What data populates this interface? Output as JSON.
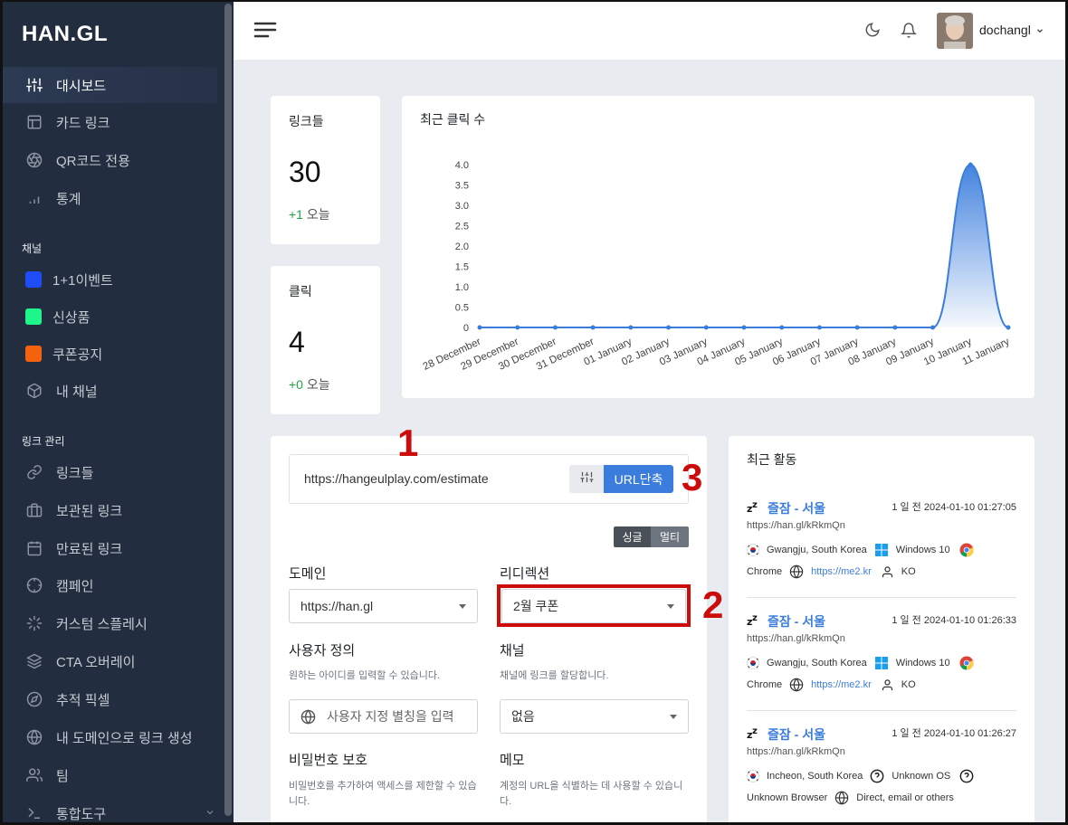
{
  "brand": {
    "logo": "HAN.GL"
  },
  "sidebar": {
    "main_items": [
      {
        "label": "대시보드",
        "icon": "sliders-icon"
      },
      {
        "label": "카드 링크",
        "icon": "layout-icon"
      },
      {
        "label": "QR코드 전용",
        "icon": "aperture-icon"
      },
      {
        "label": "통계",
        "icon": "bar-chart-icon"
      }
    ],
    "channel_header": "채널",
    "channels": [
      {
        "label": "1+1이벤트",
        "color": "#1f4cf5"
      },
      {
        "label": "신상품",
        "color": "#1ef58a"
      },
      {
        "label": "쿠폰공지",
        "color": "#f2620f"
      },
      {
        "label": "내 채널",
        "icon": "box-icon"
      }
    ],
    "link_header": "링크 관리",
    "link_items": [
      {
        "label": "링크들",
        "icon": "link-icon"
      },
      {
        "label": "보관된 링크",
        "icon": "briefcase-icon"
      },
      {
        "label": "만료된 링크",
        "icon": "calendar-icon"
      },
      {
        "label": "캠페인",
        "icon": "crosshair-icon"
      },
      {
        "label": "커스텀 스플레시",
        "icon": "loader-icon"
      },
      {
        "label": "CTA 오버레이",
        "icon": "layers-icon"
      },
      {
        "label": "추적 픽셀",
        "icon": "compass-icon"
      },
      {
        "label": "내 도메인으로 링크 생성",
        "icon": "globe-icon"
      },
      {
        "label": "팀",
        "icon": "users-icon"
      },
      {
        "label": "통합도구",
        "icon": "terminal-icon"
      }
    ]
  },
  "header": {
    "username": "dochangl"
  },
  "stats": {
    "links": {
      "title": "링크들",
      "value": "30",
      "delta": "+1",
      "delta_suffix": " 오늘"
    },
    "clicks": {
      "title": "클릭",
      "value": "4",
      "delta": "+0",
      "delta_suffix": " 오늘"
    }
  },
  "chart_data": {
    "type": "area",
    "title": "최근 클릭 수",
    "categories": [
      "28 December",
      "29 December",
      "30 December",
      "31 December",
      "01 January",
      "02 January",
      "03 January",
      "04 January",
      "05 January",
      "06 January",
      "07 January",
      "08 January",
      "09 January",
      "10 January",
      "11 January"
    ],
    "values": [
      0,
      0,
      0,
      0,
      0,
      0,
      0,
      0,
      0,
      0,
      0,
      0,
      0,
      4,
      0
    ],
    "ylim": [
      0,
      4
    ],
    "yticks": [
      "4.0",
      "3.5",
      "3.0",
      "2.5",
      "2.0",
      "1.5",
      "1.0",
      "0.5",
      "0"
    ],
    "color": "#3b7ddd"
  },
  "shortener": {
    "url_value": "https://hangeulplay.com/estimate",
    "shorten_label": "URL단축",
    "single_label": "싱글",
    "multi_label": "멀티",
    "domain_label": "도메인",
    "domain_value": "https://han.gl",
    "redirect_label": "리디렉션",
    "redirect_value": "2월 쿠폰",
    "custom_label": "사용자 정의",
    "custom_help": "원하는 아이디를 입력할 수 있습니다.",
    "custom_placeholder": "사용자 지정 별칭을 입력",
    "channel_label": "채널",
    "channel_help": "채널에 링크를 할당합니다.",
    "channel_value": "없음",
    "password_label": "비밀번호 보호",
    "password_help": "비밀번호를 추가하여 액세스를 제한할 수 있습니다.",
    "memo_label": "메모",
    "memo_help": "계정의 URL을 식별하는 데 사용할 수 있습니다."
  },
  "annotations": {
    "n1": "1",
    "n2": "2",
    "n3": "3"
  },
  "activity": {
    "title": "최근 활동",
    "items": [
      {
        "title": "즐잠 - 서울",
        "time": "1 일 전 2024-01-10 01:27:05",
        "url": "https://han.gl/kRkmQn",
        "location": "Gwangju, South Korea",
        "os": "Windows 10",
        "browser": "Chrome",
        "referrer": "https://me2.kr",
        "lang": "KO"
      },
      {
        "title": "즐잠 - 서울",
        "time": "1 일 전 2024-01-10 01:26:33",
        "url": "https://han.gl/kRkmQn",
        "location": "Gwangju, South Korea",
        "os": "Windows 10",
        "browser": "Chrome",
        "referrer": "https://me2.kr",
        "lang": "KO"
      },
      {
        "title": "즐잠 - 서울",
        "time": "1 일 전 2024-01-10 01:26:27",
        "url": "https://han.gl/kRkmQn",
        "location": "Incheon, South Korea",
        "os": "Unknown OS",
        "browser": "Unknown Browser",
        "referrer": "Direct, email or others",
        "lang": ""
      }
    ]
  }
}
